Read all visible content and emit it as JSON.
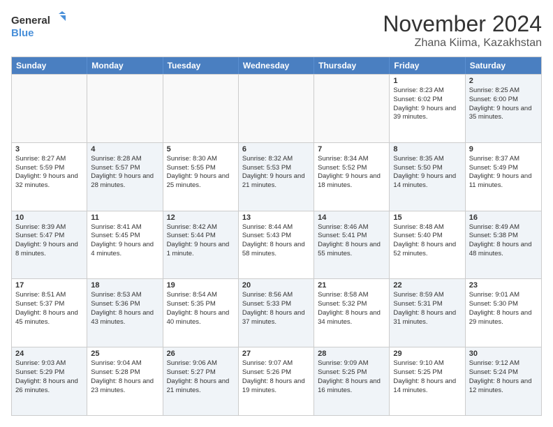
{
  "logo": {
    "line1": "General",
    "line2": "Blue"
  },
  "title": "November 2024",
  "subtitle": "Zhana Kiima, Kazakhstan",
  "days": [
    "Sunday",
    "Monday",
    "Tuesday",
    "Wednesday",
    "Thursday",
    "Friday",
    "Saturday"
  ],
  "rows": [
    [
      {
        "day": "",
        "text": "",
        "empty": true
      },
      {
        "day": "",
        "text": "",
        "empty": true
      },
      {
        "day": "",
        "text": "",
        "empty": true
      },
      {
        "day": "",
        "text": "",
        "empty": true
      },
      {
        "day": "",
        "text": "",
        "empty": true
      },
      {
        "day": "1",
        "text": "Sunrise: 8:23 AM\nSunset: 6:02 PM\nDaylight: 9 hours and 39 minutes."
      },
      {
        "day": "2",
        "text": "Sunrise: 8:25 AM\nSunset: 6:00 PM\nDaylight: 9 hours and 35 minutes.",
        "shaded": true
      }
    ],
    [
      {
        "day": "3",
        "text": "Sunrise: 8:27 AM\nSunset: 5:59 PM\nDaylight: 9 hours and 32 minutes."
      },
      {
        "day": "4",
        "text": "Sunrise: 8:28 AM\nSunset: 5:57 PM\nDaylight: 9 hours and 28 minutes.",
        "shaded": true
      },
      {
        "day": "5",
        "text": "Sunrise: 8:30 AM\nSunset: 5:55 PM\nDaylight: 9 hours and 25 minutes."
      },
      {
        "day": "6",
        "text": "Sunrise: 8:32 AM\nSunset: 5:53 PM\nDaylight: 9 hours and 21 minutes.",
        "shaded": true
      },
      {
        "day": "7",
        "text": "Sunrise: 8:34 AM\nSunset: 5:52 PM\nDaylight: 9 hours and 18 minutes."
      },
      {
        "day": "8",
        "text": "Sunrise: 8:35 AM\nSunset: 5:50 PM\nDaylight: 9 hours and 14 minutes.",
        "shaded": true
      },
      {
        "day": "9",
        "text": "Sunrise: 8:37 AM\nSunset: 5:49 PM\nDaylight: 9 hours and 11 minutes."
      }
    ],
    [
      {
        "day": "10",
        "text": "Sunrise: 8:39 AM\nSunset: 5:47 PM\nDaylight: 9 hours and 8 minutes.",
        "shaded": true
      },
      {
        "day": "11",
        "text": "Sunrise: 8:41 AM\nSunset: 5:45 PM\nDaylight: 9 hours and 4 minutes."
      },
      {
        "day": "12",
        "text": "Sunrise: 8:42 AM\nSunset: 5:44 PM\nDaylight: 9 hours and 1 minute.",
        "shaded": true
      },
      {
        "day": "13",
        "text": "Sunrise: 8:44 AM\nSunset: 5:43 PM\nDaylight: 8 hours and 58 minutes."
      },
      {
        "day": "14",
        "text": "Sunrise: 8:46 AM\nSunset: 5:41 PM\nDaylight: 8 hours and 55 minutes.",
        "shaded": true
      },
      {
        "day": "15",
        "text": "Sunrise: 8:48 AM\nSunset: 5:40 PM\nDaylight: 8 hours and 52 minutes."
      },
      {
        "day": "16",
        "text": "Sunrise: 8:49 AM\nSunset: 5:38 PM\nDaylight: 8 hours and 48 minutes.",
        "shaded": true
      }
    ],
    [
      {
        "day": "17",
        "text": "Sunrise: 8:51 AM\nSunset: 5:37 PM\nDaylight: 8 hours and 45 minutes."
      },
      {
        "day": "18",
        "text": "Sunrise: 8:53 AM\nSunset: 5:36 PM\nDaylight: 8 hours and 43 minutes.",
        "shaded": true
      },
      {
        "day": "19",
        "text": "Sunrise: 8:54 AM\nSunset: 5:35 PM\nDaylight: 8 hours and 40 minutes."
      },
      {
        "day": "20",
        "text": "Sunrise: 8:56 AM\nSunset: 5:33 PM\nDaylight: 8 hours and 37 minutes.",
        "shaded": true
      },
      {
        "day": "21",
        "text": "Sunrise: 8:58 AM\nSunset: 5:32 PM\nDaylight: 8 hours and 34 minutes."
      },
      {
        "day": "22",
        "text": "Sunrise: 8:59 AM\nSunset: 5:31 PM\nDaylight: 8 hours and 31 minutes.",
        "shaded": true
      },
      {
        "day": "23",
        "text": "Sunrise: 9:01 AM\nSunset: 5:30 PM\nDaylight: 8 hours and 29 minutes."
      }
    ],
    [
      {
        "day": "24",
        "text": "Sunrise: 9:03 AM\nSunset: 5:29 PM\nDaylight: 8 hours and 26 minutes.",
        "shaded": true
      },
      {
        "day": "25",
        "text": "Sunrise: 9:04 AM\nSunset: 5:28 PM\nDaylight: 8 hours and 23 minutes."
      },
      {
        "day": "26",
        "text": "Sunrise: 9:06 AM\nSunset: 5:27 PM\nDaylight: 8 hours and 21 minutes.",
        "shaded": true
      },
      {
        "day": "27",
        "text": "Sunrise: 9:07 AM\nSunset: 5:26 PM\nDaylight: 8 hours and 19 minutes."
      },
      {
        "day": "28",
        "text": "Sunrise: 9:09 AM\nSunset: 5:25 PM\nDaylight: 8 hours and 16 minutes.",
        "shaded": true
      },
      {
        "day": "29",
        "text": "Sunrise: 9:10 AM\nSunset: 5:25 PM\nDaylight: 8 hours and 14 minutes."
      },
      {
        "day": "30",
        "text": "Sunrise: 9:12 AM\nSunset: 5:24 PM\nDaylight: 8 hours and 12 minutes.",
        "shaded": true
      }
    ]
  ]
}
